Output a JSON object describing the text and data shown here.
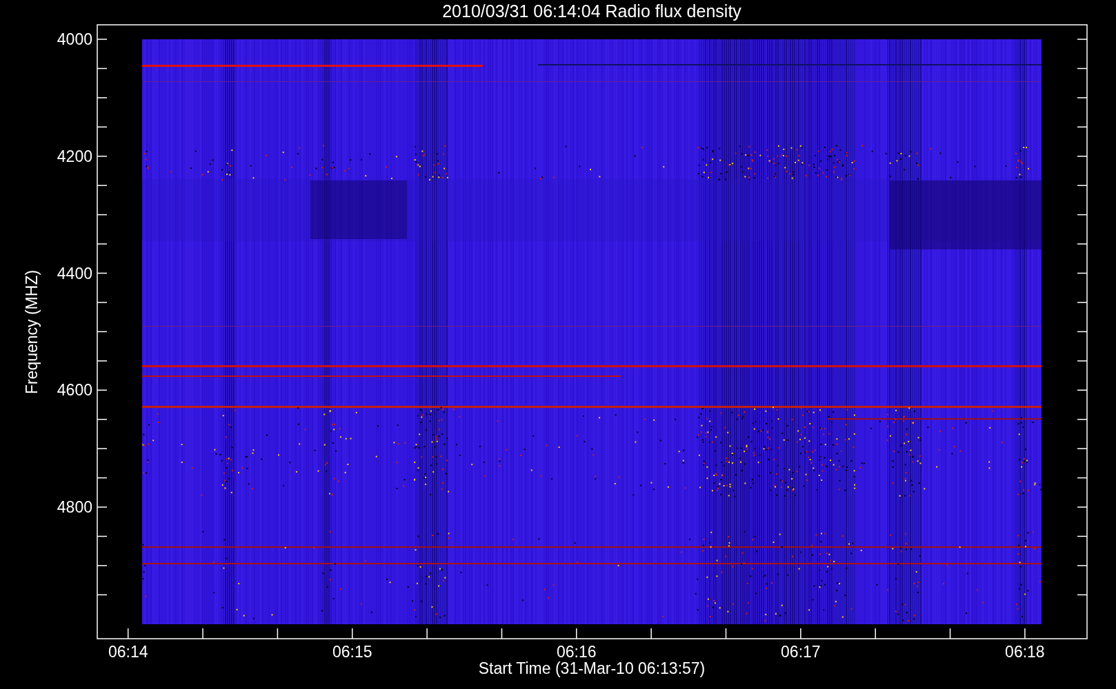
{
  "plot": {
    "title": "2010/03/31 06:14:04 Radio flux density",
    "ylabel": "Frequency (MHZ)",
    "xlabel": "Start Time (31-Mar-10 06:13:57)",
    "yticks": [
      "4000",
      "4200",
      "4400",
      "4600",
      "4800"
    ],
    "xticks": [
      "06:14",
      "06:15",
      "06:16",
      "06:17",
      "06:18"
    ]
  }
}
